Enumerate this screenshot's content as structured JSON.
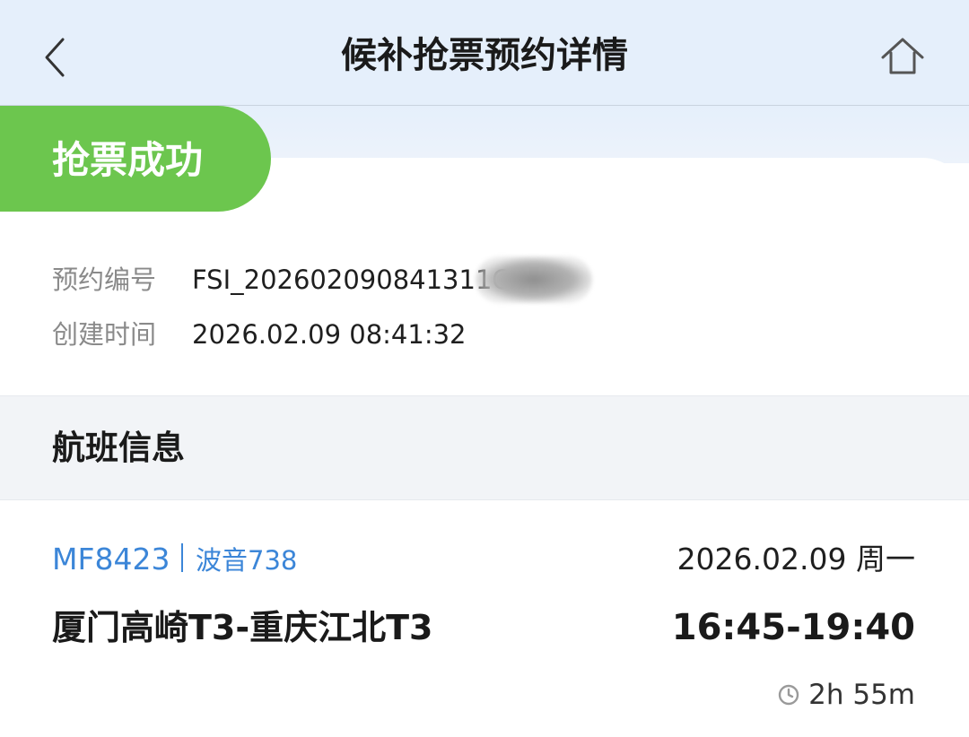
{
  "header": {
    "title": "候补抢票预约详情",
    "back_icon": "chevron-left-icon",
    "home_icon": "home-icon"
  },
  "status": {
    "label": "抢票成功",
    "color": "#6cc64e"
  },
  "booking": {
    "reservation_label": "预约编号",
    "reservation_value": "FSI_202602090841311C",
    "created_label": "创建时间",
    "created_value": "2026.02.09 08:41:32"
  },
  "flight_section": {
    "title": "航班信息"
  },
  "flight": {
    "flight_no": "MF8423",
    "aircraft": "波音738",
    "date": "2026.02.09 周一",
    "route": "厦门高崎T3-重庆江北T3",
    "times": "16:45-19:40",
    "duration": "2h 55m",
    "duration_icon": "clock-icon",
    "accent_color": "#3c86d8"
  }
}
